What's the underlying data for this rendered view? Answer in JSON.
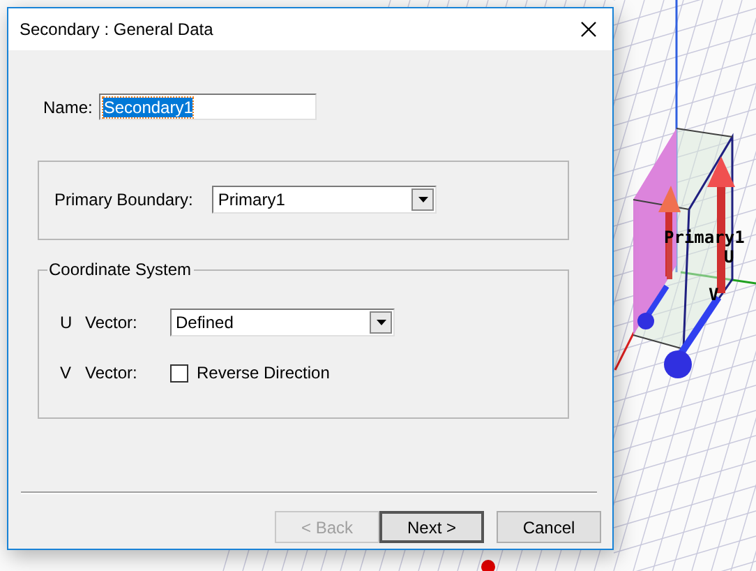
{
  "viewport": {
    "labels": [
      {
        "text": "Primary1"
      },
      {
        "text": "U"
      },
      {
        "text": "V"
      }
    ]
  },
  "window": {
    "title": "Secondary : General Data"
  },
  "name_field": {
    "label": "Name:",
    "value": "Secondary1",
    "selected": true
  },
  "primary_boundary": {
    "label": "Primary Boundary:",
    "value": "Primary1"
  },
  "coordinate_system": {
    "title": "Coordinate System",
    "u_vector": {
      "axis": "U",
      "label": "Vector:",
      "value": "Defined"
    },
    "v_vector": {
      "axis": "V",
      "label": "Vector:",
      "checkbox_label": "Reverse Direction",
      "checked": false
    }
  },
  "buttons": [
    {
      "label": "< Back",
      "disabled": true,
      "default": false
    },
    {
      "label": "Next >",
      "disabled": false,
      "default": true
    },
    {
      "label": "Cancel",
      "disabled": false,
      "default": false
    }
  ]
}
